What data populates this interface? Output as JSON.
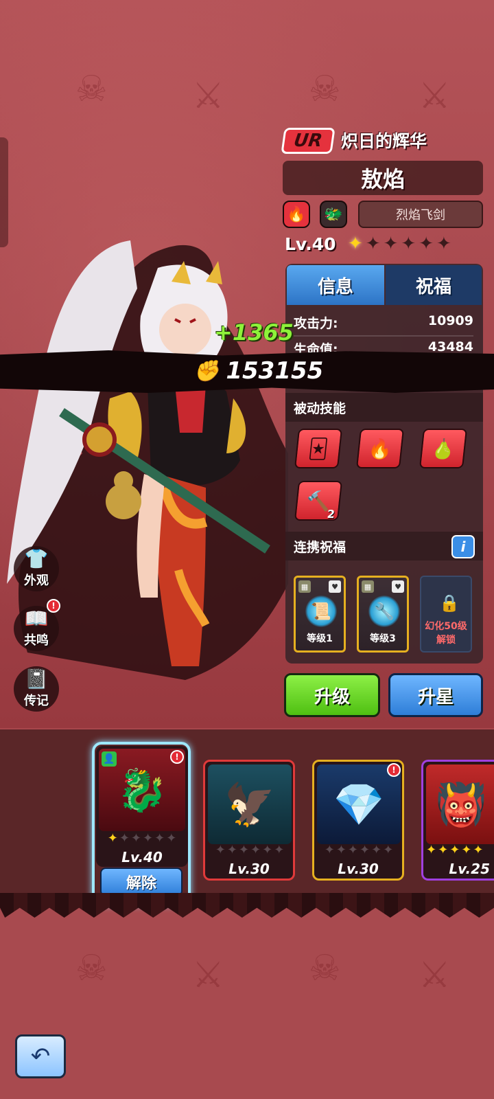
{
  "hero": {
    "rarity": "UR",
    "title": "炽日的辉华",
    "name": "敖焰",
    "weapon_tag": "烈焰飞剑",
    "level": "Lv.40",
    "stars_filled": 1,
    "stars_total": 6,
    "element_icon": "fire-icon",
    "class_icon": "dragon-icon"
  },
  "tabs": {
    "info": "信息",
    "blessing": "祝福"
  },
  "stats": [
    {
      "label": "攻击力:",
      "value": "10909"
    },
    {
      "label": "生命值:",
      "value": "43484"
    }
  ],
  "power": {
    "value": "153155",
    "delta": "+1365"
  },
  "passive": {
    "heading": "被动技能",
    "skills": [
      {
        "icon": "cards-icon",
        "badge": ""
      },
      {
        "icon": "flame-icon",
        "badge": ""
      },
      {
        "icon": "gourd-icon",
        "badge": ""
      },
      {
        "icon": "staff-icon",
        "badge": "2"
      }
    ]
  },
  "link_blessing": {
    "heading": "连携祝福",
    "info_label": "i",
    "items": [
      {
        "label": "等级1",
        "icon": "scroll-icon"
      },
      {
        "label": "等级3",
        "icon": "wrench-icon"
      }
    ],
    "locked_line1": "幻化50级",
    "locked_line2": "解锁"
  },
  "actions": {
    "upgrade": "升级",
    "star_up": "升星"
  },
  "side_menu": {
    "appearance": "外观",
    "resonance": "共鸣",
    "biography": "传记"
  },
  "hero_cards": [
    {
      "level": "Lv.40",
      "stars_on": 1,
      "alert": true,
      "selected": true
    },
    {
      "level": "Lv.30",
      "stars_on": 0,
      "alert": false,
      "selected": false
    },
    {
      "level": "Lv.30",
      "stars_on": 0,
      "alert": true,
      "selected": false
    },
    {
      "level": "Lv.25",
      "stars_on": 5,
      "alert": false,
      "selected": false
    }
  ],
  "unequip_label": "解除",
  "colors": {
    "accent_red": "#e5323d",
    "tab_blue": "#2d74c6",
    "upgrade_green": "#6ad928",
    "star_blue": "#3a8ee6",
    "gold": "#ffd21a"
  }
}
